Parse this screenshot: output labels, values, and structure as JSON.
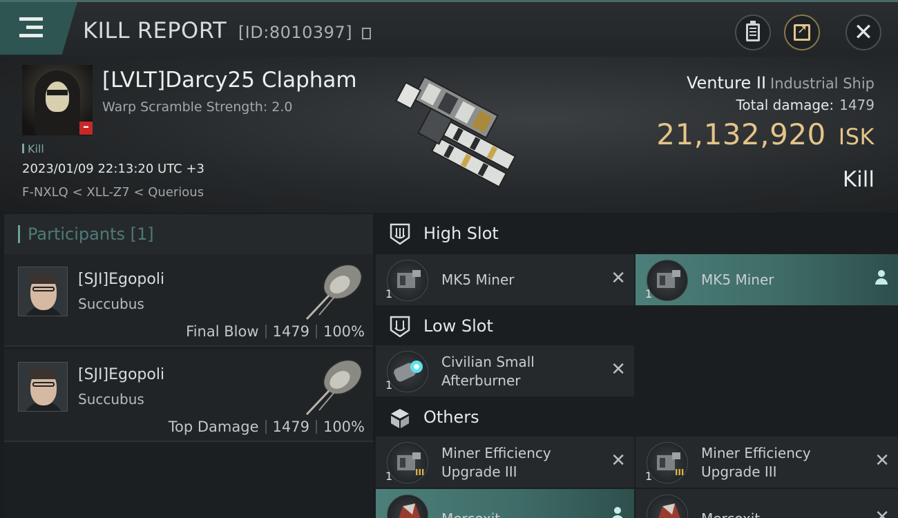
{
  "topbar": {
    "title": "KILL REPORT",
    "report_id": "[ID:8010397]",
    "icons": [
      "menu-icon",
      "copy-id-icon",
      "clipboard-icon",
      "share-icon",
      "close-icon"
    ]
  },
  "victim": {
    "name": "[LVLT]Darcy25 Clapham",
    "warp_scramble": "Warp Scramble Strength: 2.0",
    "tag": "Kill",
    "datetime": "2023/01/09 22:13:20 UTC +3",
    "location": "F-NXLQ < XLL-Z7 < Querious",
    "ship_name": "Venture II",
    "ship_class": "Industrial Ship",
    "total_damage_label": "Total damage:",
    "total_damage_value": "1479",
    "isk_value": "21,132,920",
    "isk_unit": "ISK",
    "result": "Kill"
  },
  "participants": {
    "header": "Participants [1]",
    "rows": [
      {
        "name": "[SJI]Egopoli",
        "ship": "Succubus",
        "role": "Final Blow",
        "damage": "1479",
        "percent": "100%"
      },
      {
        "name": "[SJI]Egopoli",
        "ship": "Succubus",
        "role": "Top Damage",
        "damage": "1479",
        "percent": "100%"
      }
    ]
  },
  "slots": {
    "high": {
      "title": "High Slot",
      "items": [
        {
          "name": "MK5 Miner",
          "qty": "1",
          "state": "destroyed"
        },
        {
          "name": "MK5 Miner",
          "qty": "1",
          "state": "dropped"
        }
      ]
    },
    "low": {
      "title": "Low Slot",
      "items": [
        {
          "name_line1": "Civilian Small",
          "name_line2": "Afterburner",
          "qty": "1",
          "state": "destroyed"
        }
      ]
    },
    "others": {
      "title": "Others",
      "items": [
        {
          "name_line1": "Miner Efficiency",
          "name_line2": "Upgrade III",
          "qty": "1",
          "tier": "III",
          "state": "destroyed"
        },
        {
          "name_line1": "Miner Efficiency",
          "name_line2": "Upgrade III",
          "qty": "1",
          "tier": "III",
          "state": "destroyed"
        },
        {
          "name": "Mercoxit",
          "state": "dropped"
        },
        {
          "name": "Mercoxit",
          "state": "destroyed"
        }
      ]
    }
  },
  "colors": {
    "accent_teal": "#4c7f79",
    "isk_gold": "#e4c489",
    "menu_tab": "#2f5553",
    "destroyed_x": "#b8bdbf",
    "dropped_person": "#c6ecea"
  }
}
